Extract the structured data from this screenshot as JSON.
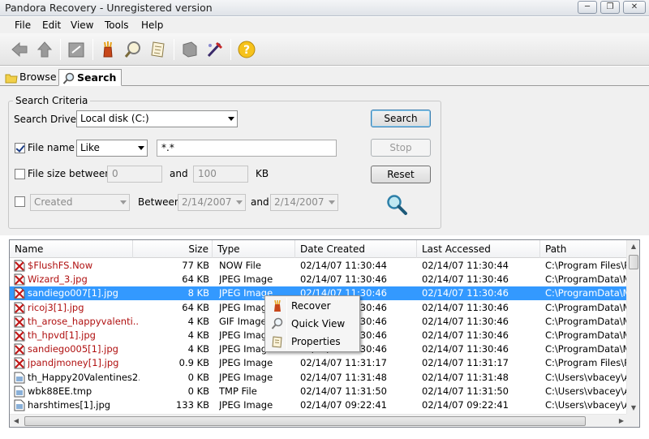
{
  "window": {
    "title": "Pandora Recovery - Unregistered version"
  },
  "menu": [
    "File",
    "Edit",
    "View",
    "Tools",
    "Help"
  ],
  "toolbar": {
    "icons": [
      "back-icon",
      "forward-icon",
      "up-folder-icon",
      "recover-icon",
      "quick-view-icon",
      "properties-icon",
      "disk-icon",
      "wand-icon",
      "help-icon"
    ]
  },
  "tabs": [
    {
      "label": "Browse"
    },
    {
      "label": "Search",
      "active": true
    }
  ],
  "criteria": {
    "group_title": "Search Criteria",
    "drive_label": "Search Drive:",
    "drive_value": "Local disk (C:)",
    "filename_label": "File name",
    "filename_checked": true,
    "filename_op": "Like",
    "filename_value": "*.*",
    "size_label": "File size between:",
    "size_checked": false,
    "size_min": "0",
    "size_and": "and",
    "size_max": "100",
    "size_unit": "KB",
    "date_checked": false,
    "date_type": "Created",
    "between_label": "Between",
    "date_from": "2/14/2007",
    "date_and": "and",
    "date_to": "2/14/2007"
  },
  "buttons": {
    "search": "Search",
    "stop": "Stop",
    "reset": "Reset"
  },
  "table": {
    "columns": {
      "name": "Name",
      "size": "Size",
      "type": "Type",
      "created": "Date Created",
      "accessed": "Last Accessed",
      "path": "Path"
    },
    "rows": [
      {
        "name": "$FlushFS.Now",
        "size": "77 KB",
        "type": "NOW File",
        "created": "02/14/07 11:30:44",
        "accessed": "02/14/07 11:30:44",
        "path": "C:\\Program Files\\Pan",
        "deleted": true
      },
      {
        "name": "Wizard_3.jpg",
        "size": "64 KB",
        "type": "JPEG Image",
        "created": "02/14/07 11:30:46",
        "accessed": "02/14/07 11:30:46",
        "path": "C:\\ProgramData\\Micr",
        "deleted": true
      },
      {
        "name": "sandiego007[1].jpg",
        "size": "8 KB",
        "type": "JPEG Image",
        "created": "02/14/07 11:30:46",
        "accessed": "02/14/07 11:30:46",
        "path": "C:\\ProgramData\\Micr",
        "deleted": true,
        "selected": true
      },
      {
        "name": "ricoj3[1].jpg",
        "size": "64 KB",
        "type": "JPEG Image",
        "created": "02/14/07 11:30:46",
        "accessed": "02/14/07 11:30:46",
        "path": "C:\\ProgramData\\Micr",
        "deleted": true
      },
      {
        "name": "th_arose_happyvalenti...",
        "size": "4 KB",
        "type": "GIF Image",
        "created": "02/14/07 11:30:46",
        "accessed": "02/14/07 11:30:46",
        "path": "C:\\ProgramData\\Micr",
        "deleted": true
      },
      {
        "name": "th_hpvd[1].jpg",
        "size": "4 KB",
        "type": "JPEG Image",
        "created": "02/14/07 11:30:46",
        "accessed": "02/14/07 11:30:46",
        "path": "C:\\ProgramData\\Micr",
        "deleted": true
      },
      {
        "name": "sandiego005[1].jpg",
        "size": "4 KB",
        "type": "JPEG Image",
        "created": "02/14/07 11:30:46",
        "accessed": "02/14/07 11:30:46",
        "path": "C:\\ProgramData\\Micr",
        "deleted": true
      },
      {
        "name": "jpandjmoney[1].jpg",
        "size": "0.9 KB",
        "type": "JPEG Image",
        "created": "02/14/07 11:31:17",
        "accessed": "02/14/07 11:31:17",
        "path": "C:\\Program Files\\Pan",
        "deleted": true
      },
      {
        "name": "th_Happy20Valentines2...",
        "size": "0 KB",
        "type": "JPEG Image",
        "created": "02/14/07 11:31:48",
        "accessed": "02/14/07 11:31:48",
        "path": "C:\\Users\\vbacey\\Ap",
        "deleted": false
      },
      {
        "name": "wbk88EE.tmp",
        "size": "0 KB",
        "type": "TMP File",
        "created": "02/14/07 11:31:50",
        "accessed": "02/14/07 11:31:50",
        "path": "C:\\Users\\vbacey\\Ap",
        "deleted": false
      },
      {
        "name": "harshtimes[1].jpg",
        "size": "133 KB",
        "type": "JPEG Image",
        "created": "02/14/07 09:22:41",
        "accessed": "02/14/07 09:22:41",
        "path": "C:\\Users\\vbacey\\Ap",
        "deleted": false
      }
    ]
  },
  "context_menu": {
    "items": [
      {
        "label": "Recover",
        "icon": "recover-icon"
      },
      {
        "label": "Quick View",
        "icon": "quick-view-icon"
      },
      {
        "label": "Properties",
        "icon": "properties-icon"
      }
    ]
  },
  "colors": {
    "selection": "#3399ff",
    "deleted_text": "#b01010"
  }
}
